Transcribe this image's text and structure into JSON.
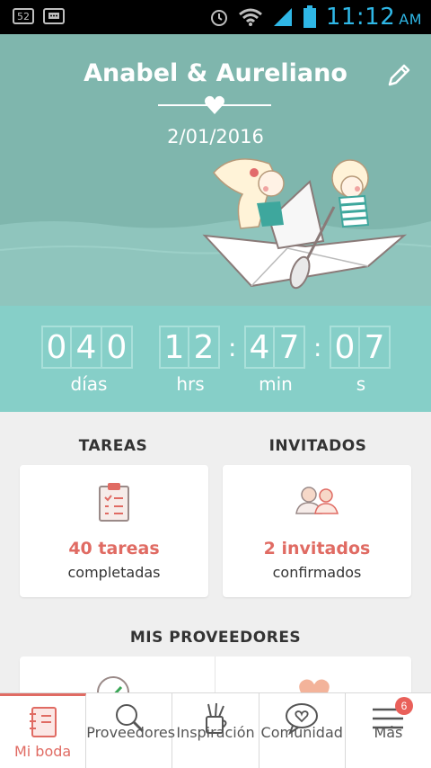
{
  "status_bar": {
    "battery_notice": "52",
    "time": "11:12",
    "ampm": "AM"
  },
  "hero": {
    "title": "Anabel & Aureliano",
    "date": "2/01/2016"
  },
  "countdown": {
    "days_digits": [
      "0",
      "4",
      "0"
    ],
    "hours_digits": [
      "1",
      "2"
    ],
    "minutes_digits": [
      "4",
      "7"
    ],
    "seconds_digits": [
      "0",
      "7"
    ],
    "labels": {
      "days": "días",
      "hours": "hrs",
      "minutes": "min",
      "seconds": "s"
    },
    "separator": ":"
  },
  "sections": {
    "tasks": {
      "title": "TAREAS",
      "count": "40 tareas",
      "sub": "completadas"
    },
    "guests": {
      "title": "INVITADOS",
      "count": "2 invitados",
      "sub": "confirmados"
    },
    "vendors": {
      "title": "MIS PROVEEDORES"
    }
  },
  "bottom_nav": {
    "items": [
      {
        "label": "Mi boda",
        "icon": "notebook-icon"
      },
      {
        "label": "Proveedores",
        "icon": "search-icon"
      },
      {
        "label": "Inspiración",
        "icon": "tools-icon"
      },
      {
        "label": "Comunidad",
        "icon": "chat-heart-icon"
      },
      {
        "label": "Más",
        "icon": "menu-icon"
      }
    ],
    "badge": "6"
  },
  "colors": {
    "hero_bg": "#7fb6ad",
    "countdown_bg": "#86cfc8",
    "accent": "#e06b63",
    "status_time": "#2fb7e6"
  }
}
